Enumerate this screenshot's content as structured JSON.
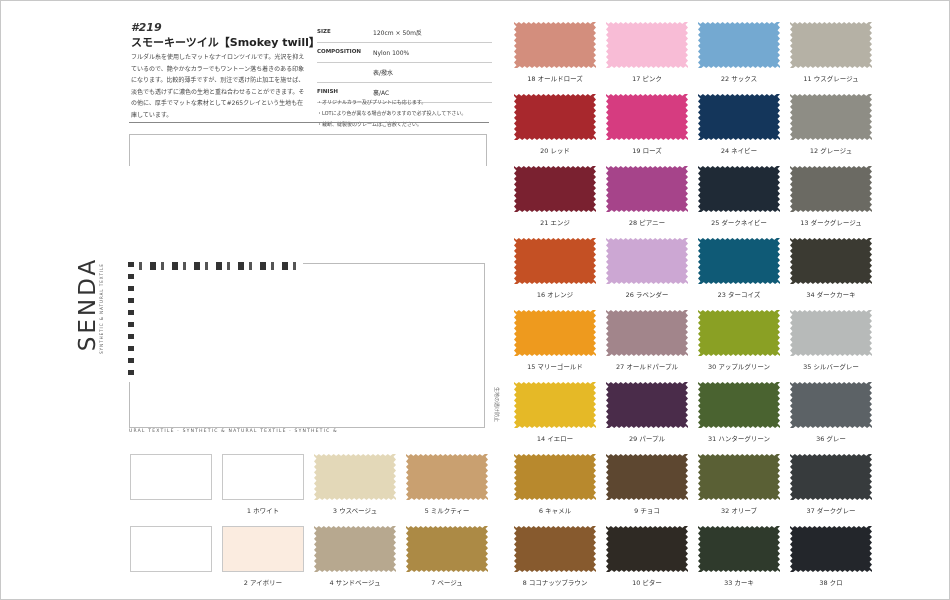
{
  "brand": {
    "logo": "SENDA",
    "tagline": "SYNTHETIC & NATURAL TEXTILE"
  },
  "product": {
    "code": "#219",
    "title": "スモーキーツイル【Smokey twill】",
    "description": "フルダル糸を使用したマットなナイロンツイルです。光沢を抑えているので、艶やかなカラーでもワントーン落ち着きのある印象になります。比較的薄手ですが、別注で透け防止加工を施せば、淡色でも透けずに濃色の生地と重ね合わせることができます。その他に、厚手でマットな素材として#265クレイという生地も在庫しています。"
  },
  "specs": [
    {
      "key": "SIZE",
      "lines": [
        "120cm × 50m反"
      ]
    },
    {
      "key": "COMPOSITION",
      "lines": [
        "Nylon 100%"
      ]
    },
    {
      "key": "",
      "lines": [
        "表/撥水"
      ]
    },
    {
      "key": "FINISH",
      "lines": [
        "裏/AC"
      ]
    }
  ],
  "notes": [
    "・オリジナルカラー及びプリントにも応じます。",
    "・LOTにより色が異なる場合がありますので必ず投入して下さい。",
    "・裁断、縫製後のクレームはご容赦ください。"
  ],
  "vertical_note": "生地の透け防止",
  "footer_text": "URAL TEXTILE · SYNTHETIC & NATURAL TEXTILE · SYNTHETIC &",
  "left_swatches": [
    {
      "label": "",
      "color": "#ffffff",
      "style": "plain"
    },
    {
      "label": "1 ホワイト",
      "color": "#ffffff",
      "style": "plain"
    },
    {
      "label": "3 ウスベージュ",
      "color": "#e3d8b8",
      "style": "zig"
    },
    {
      "label": "5 ミルクティー",
      "color": "#c9a070",
      "style": "zig"
    },
    {
      "label": "",
      "color": "#ffffff",
      "style": "plain"
    },
    {
      "label": "2 アイボリー",
      "color": "#fbece0",
      "style": "plain"
    },
    {
      "label": "4 サンドベージュ",
      "color": "#b7a88f",
      "style": "zig"
    },
    {
      "label": "7 ベージュ",
      "color": "#ac8a45",
      "style": "zig"
    }
  ],
  "right_swatches": [
    {
      "label": "18 オールドローズ",
      "color": "#d38e7d"
    },
    {
      "label": "17 ピンク",
      "color": "#f8bcd6"
    },
    {
      "label": "22 サックス",
      "color": "#74a9d1"
    },
    {
      "label": "11 ウスグレージュ",
      "color": "#b5b1a5"
    },
    {
      "label": "20 レッド",
      "color": "#a8282d"
    },
    {
      "label": "19 ローズ",
      "color": "#d63c80"
    },
    {
      "label": "24 ネイビー",
      "color": "#14365b"
    },
    {
      "label": "12 グレージュ",
      "color": "#8e8d85"
    },
    {
      "label": "21 エンジ",
      "color": "#7a2130"
    },
    {
      "label": "28 ピアニー",
      "color": "#a6448a"
    },
    {
      "label": "25 ダークネイビー",
      "color": "#1f2a36"
    },
    {
      "label": "13 ダークグレージュ",
      "color": "#6b6a63"
    },
    {
      "label": "16 オレンジ",
      "color": "#c45024"
    },
    {
      "label": "26 ラベンダー",
      "color": "#cca7d3"
    },
    {
      "label": "23 ターコイズ",
      "color": "#0f5a76"
    },
    {
      "label": "34 ダークカーキ",
      "color": "#3b3a32"
    },
    {
      "label": "15 マリーゴールド",
      "color": "#ee9a1e"
    },
    {
      "label": "27 オールドパープル",
      "color": "#a2858b"
    },
    {
      "label": "30 アップルグリーン",
      "color": "#8aa024"
    },
    {
      "label": "35 シルバーグレー",
      "color": "#b7bab9"
    },
    {
      "label": "14 イエロー",
      "color": "#e5b927"
    },
    {
      "label": "29 パープル",
      "color": "#4a2c4a"
    },
    {
      "label": "31 ハンターグリーン",
      "color": "#4a6330"
    },
    {
      "label": "36 グレー",
      "color": "#5c6266"
    },
    {
      "label": "6 キャメル",
      "color": "#b8892d"
    },
    {
      "label": "9 チョコ",
      "color": "#5d4730"
    },
    {
      "label": "32 オリーブ",
      "color": "#5a6035"
    },
    {
      "label": "37 ダークグレー",
      "color": "#373b3d"
    },
    {
      "label": "8 ココナッツブラウン",
      "color": "#875a2e"
    },
    {
      "label": "10 ビター",
      "color": "#2f2a24"
    },
    {
      "label": "33 カーキ",
      "color": "#2f3a2c"
    },
    {
      "label": "38 クロ",
      "color": "#23262b"
    }
  ]
}
